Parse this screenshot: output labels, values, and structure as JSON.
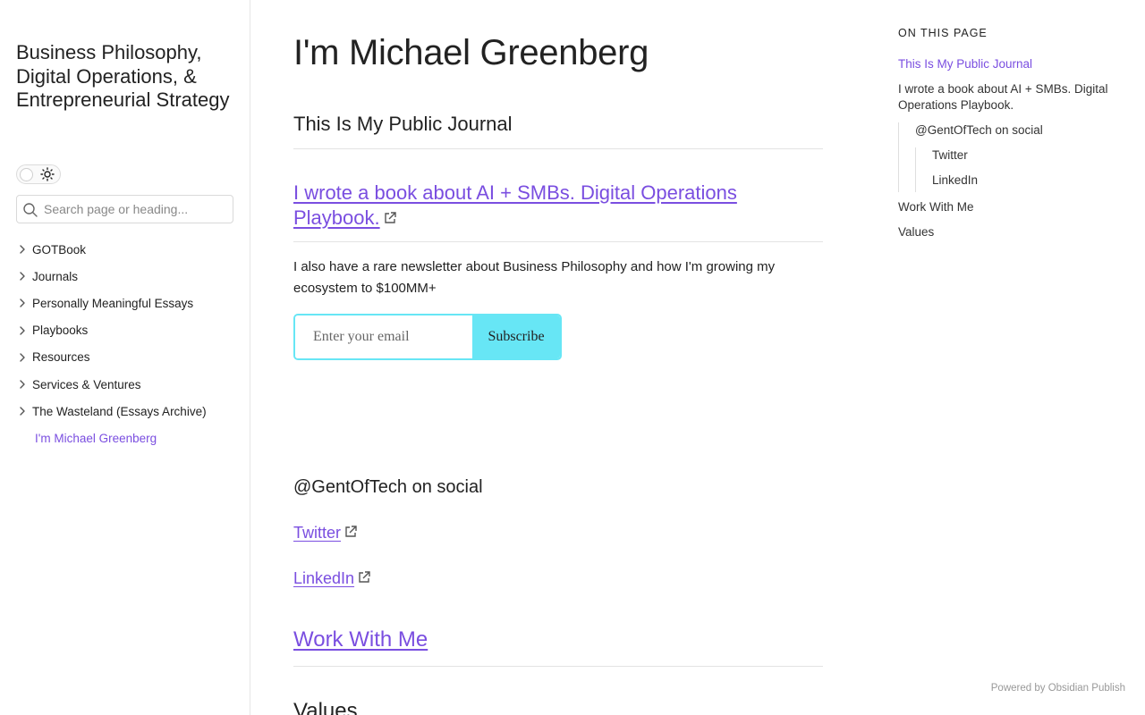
{
  "sidebar": {
    "site_title": "Business Philosophy, Digital Operations, & Entrepreneurial Strategy",
    "search_placeholder": "Search page or heading...",
    "nav_items": [
      "GOTBook",
      "Journals",
      "Personally Meaningful Essays",
      "Playbooks",
      "Resources",
      "Services & Ventures",
      "The Wasteland (Essays Archive)"
    ],
    "current_page": "I'm Michael Greenberg"
  },
  "main": {
    "title": "I'm Michael Greenberg",
    "section_journal": "This Is My Public Journal",
    "book_link": "I wrote a book about AI + SMBs. Digital Operations Playbook.",
    "newsletter_text": "I also have a rare newsletter about Business Philosophy and how I'm growing my ecosystem to $100MM+",
    "email_placeholder": "Enter your email",
    "subscribe_label": "Subscribe",
    "social_heading": "@GentOfTech on social",
    "twitter": "Twitter",
    "linkedin": "LinkedIn",
    "work_with_me": "Work With Me",
    "values": "Values"
  },
  "toc": {
    "heading": "ON THIS PAGE",
    "items": [
      "This Is My Public Journal",
      "I wrote a book about AI + SMBs. Digital Operations Playbook.",
      "@GentOfTech on social",
      "Twitter",
      "LinkedIn",
      "Work With Me",
      "Values"
    ]
  },
  "footer": {
    "powered_by": "Powered by Obsidian Publish"
  },
  "colors": {
    "accent": "#7a4ee0",
    "subscribe": "#67e6f5",
    "text": "#222222"
  }
}
